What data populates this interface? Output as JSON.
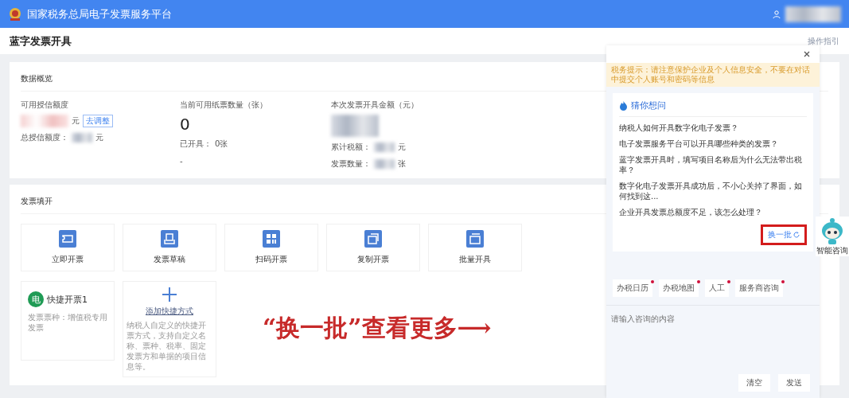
{
  "topbar": {
    "title": "国家税务总局电子发票服务平台"
  },
  "header": {
    "title": "蓝字发票开具",
    "guide_link": "操作指引"
  },
  "overview": {
    "title": "数据概览",
    "columns": [
      {
        "label": "可用授信额度",
        "value_unit": "元",
        "tag": "去调整",
        "lines": [
          {
            "label": "总授信额度：",
            "unit": "元"
          }
        ]
      },
      {
        "label": "当前可用纸票数量（张）",
        "value": "0",
        "lines": [
          {
            "label": "已开具：",
            "value": "0张"
          },
          {
            "label": "-"
          }
        ]
      },
      {
        "label": "本次发票开具金额（元）",
        "lines": [
          {
            "label": "累计税额：",
            "unit": "元"
          },
          {
            "label": "发票数量：",
            "unit": "张"
          }
        ]
      }
    ]
  },
  "invoice": {
    "title": "发票填开",
    "actions": [
      {
        "label": "立即开票",
        "kind": "ticket"
      },
      {
        "label": "发票草稿",
        "kind": "draft"
      },
      {
        "label": "扫码开票",
        "kind": "qr"
      },
      {
        "label": "复制开票",
        "kind": "copy"
      },
      {
        "label": "批量开具",
        "kind": "batch"
      }
    ],
    "shortcut": {
      "badge": "电",
      "name": "快捷开票1",
      "subtitle": "发票票种：增值税专用发票"
    },
    "add_shortcut": {
      "label": "添加快捷方式",
      "description": "纳税人自定义的快捷开票方式，支持自定义名称、票种、税率、固定发票方和单据的项目信息等。"
    }
  },
  "chat": {
    "notice": "税务提示：请注意保护企业及个人信息安全，不要在对话中提交个人账号和密码等信息",
    "suggest_title": "猜你想问",
    "questions": [
      "纳税人如何开具数字化电子发票？",
      "电子发票服务平台可以开具哪些种类的发票？",
      "蓝字发票开具时，填写项目名称后为什么无法带出税率？",
      "数字化电子发票开具成功后，不小心关掉了界面，如何找到这...",
      "企业开具发票总额度不足，该怎么处理？"
    ],
    "refresh_button": "换一批",
    "quick_tags": [
      "办税日历",
      "办税地图",
      "人工",
      "服务商咨询"
    ],
    "input_placeholder": "请输入咨询的内容",
    "buttons": [
      "清空",
      "发送"
    ]
  },
  "assistant": {
    "label": "智能咨询"
  },
  "annotation": "“换一批”查看更多⟶"
}
